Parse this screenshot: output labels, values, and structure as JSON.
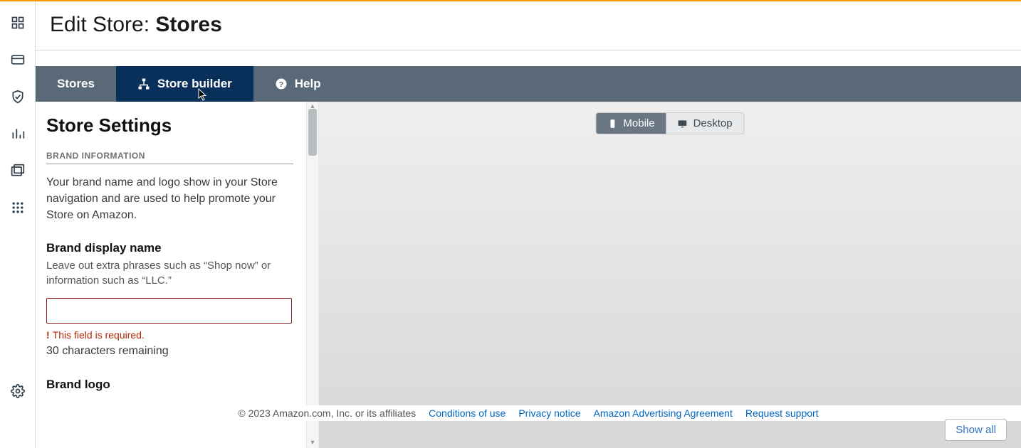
{
  "title": {
    "prefix": "Edit Store:",
    "name": "Stores"
  },
  "tabs": {
    "stores": "Stores",
    "builder": "Store builder",
    "help": "Help"
  },
  "settings": {
    "heading": "Store Settings",
    "brand_section": "BRAND INFORMATION",
    "brand_desc": "Your brand name and logo show in your Store navigation and are used to help promote your Store on Amazon.",
    "brand_name_label": "Brand display name",
    "brand_name_hint": "Leave out extra phrases such as “Shop now” or information such as “LLC.”",
    "brand_name_value": "",
    "brand_name_error": "This field is required.",
    "brand_name_remaining": "30 characters remaining",
    "brand_logo_label": "Brand logo"
  },
  "preview_toggle": {
    "mobile": "Mobile",
    "desktop": "Desktop"
  },
  "footer": {
    "copyright": "© 2023 Amazon.com, Inc. or its affiliates",
    "links": [
      "Conditions of use",
      "Privacy notice",
      "Amazon Advertising Agreement",
      "Request support"
    ]
  },
  "show_all": "Show all"
}
